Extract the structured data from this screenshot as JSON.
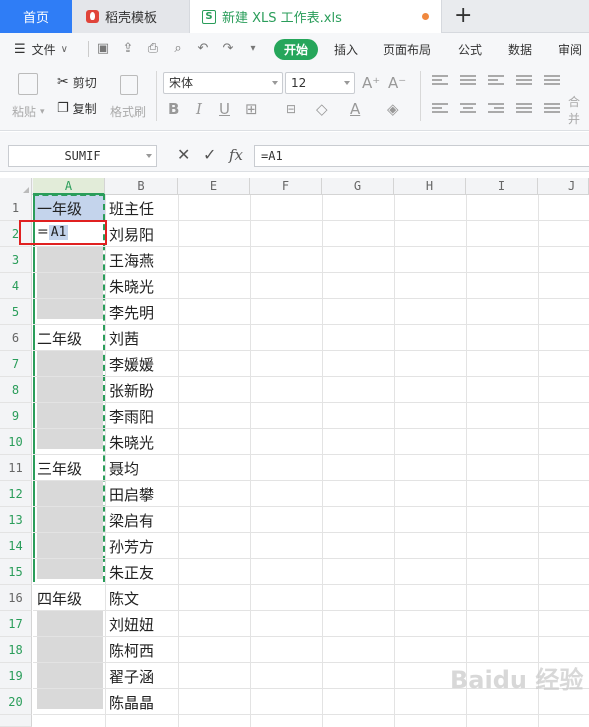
{
  "tabs": {
    "home": "首页",
    "daoke": "稻壳模板",
    "file": "新建 XLS 工作表.xls",
    "file_icon": "S",
    "new_tab": "+"
  },
  "menu": {
    "file": "文件",
    "kaishi": "开始",
    "items": [
      "插入",
      "页面布局",
      "公式",
      "数据",
      "审阅"
    ]
  },
  "ribbon": {
    "cut": "剪切",
    "paste": "粘贴",
    "copy": "复制",
    "format_painter": "格式刷",
    "font_name": "宋体",
    "font_size": "12",
    "merge": "合并"
  },
  "formula_bar": {
    "name_box": "SUMIF",
    "cancel": "✕",
    "confirm": "✓",
    "fx": "fx",
    "formula": "=A1"
  },
  "sheet": {
    "columns": [
      "A",
      "B",
      "E",
      "F",
      "G",
      "H",
      "I",
      "J"
    ],
    "rows": [
      "1",
      "2",
      "3",
      "4",
      "5",
      "6",
      "7",
      "8",
      "9",
      "10",
      "11",
      "12",
      "13",
      "14",
      "15",
      "16",
      "17",
      "18",
      "19",
      "20"
    ],
    "a1": "一年级",
    "a2_eq": "=",
    "a2_ref": "A1",
    "a6": "二年级",
    "a11": "三年级",
    "a16": "四年级",
    "col_b": [
      "班主任",
      "刘易阳",
      "王海燕",
      "朱晓光",
      "李先明",
      "刘茜",
      "李媛媛",
      "张新盼",
      "李雨阳",
      "朱晓光",
      "聂均",
      "田启攀",
      "梁启有",
      "孙芳方",
      "朱正友",
      "陈文",
      "刘妞妞",
      "陈柯西",
      "翟子涵",
      "陈晶晶"
    ]
  },
  "colors": {
    "accent_green": "#26a65b",
    "tab_blue": "#2f7df6",
    "highlight_red": "#e02020"
  }
}
